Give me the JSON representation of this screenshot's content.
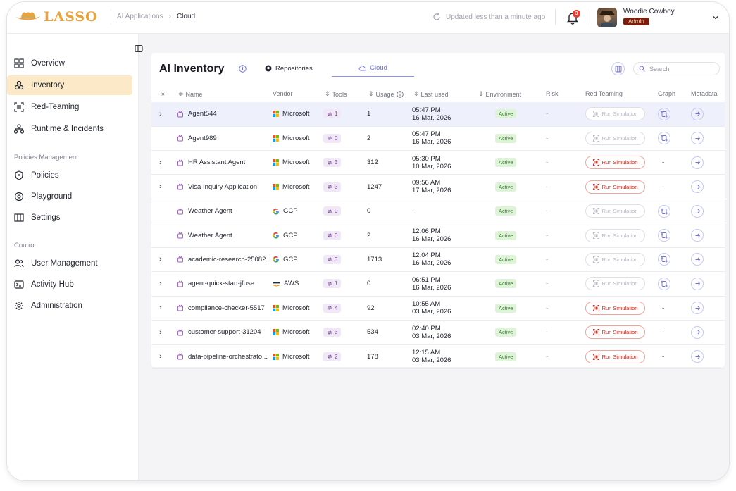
{
  "app": {
    "logo_text": "LASSO",
    "brand_color": "#e8a33d"
  },
  "breadcrumb": {
    "parent": "AI Applications",
    "current": "Cloud"
  },
  "header": {
    "updated_text": "Updated less than a minute ago",
    "notification_count": "3",
    "user_name": "Woodie Cowboy",
    "user_role": "Admin"
  },
  "sidebar": {
    "items_main": [
      {
        "label": "Overview",
        "icon": "grid-icon"
      },
      {
        "label": "Inventory",
        "icon": "inventory-icon",
        "active": true
      },
      {
        "label": "Red-Teaming",
        "icon": "red-teaming-icon"
      },
      {
        "label": "Runtime & Incidents",
        "icon": "network-icon"
      }
    ],
    "section_policies": "Policies Management",
    "items_policies": [
      {
        "label": "Policies",
        "icon": "shield-icon"
      },
      {
        "label": "Playground",
        "icon": "playground-icon"
      },
      {
        "label": "Settings",
        "icon": "columns-icon"
      }
    ],
    "section_control": "Control",
    "items_control": [
      {
        "label": "User Management",
        "icon": "users-icon"
      },
      {
        "label": "Activity Hub",
        "icon": "terminal-icon"
      },
      {
        "label": "Administration",
        "icon": "gear-icon"
      }
    ]
  },
  "main": {
    "title": "AI Inventory",
    "tabs": [
      {
        "label": "Repositories",
        "icon": "github-icon"
      },
      {
        "label": "Cloud",
        "icon": "cloud-icon",
        "active": true
      }
    ],
    "search_placeholder": "Search"
  },
  "table": {
    "columns": {
      "name": "Name",
      "vendor": "Vendor",
      "tools": "Tools",
      "usage": "Usage",
      "last_used": "Last used",
      "environment": "Environment",
      "risk": "Risk",
      "red_teaming": "Red Teaming",
      "graph": "Graph",
      "metadata": "Metadata"
    },
    "sim_label": "Run Simulation",
    "rows": [
      {
        "expand": true,
        "name": "Agent544",
        "vendor": "Microsoft",
        "tools": "1",
        "usage": "1",
        "time": "05:47 PM",
        "date": "16 Mar, 2026",
        "env": "Active",
        "risk": "-",
        "sim_enabled": false,
        "graph": true,
        "selected": true
      },
      {
        "expand": false,
        "name": "Agent989",
        "vendor": "Microsoft",
        "tools": "0",
        "usage": "2",
        "time": "05:47 PM",
        "date": "16 Mar, 2026",
        "env": "Active",
        "risk": "-",
        "sim_enabled": false,
        "graph": true
      },
      {
        "expand": true,
        "name": "HR Assistant Agent",
        "vendor": "Microsoft",
        "tools": "3",
        "usage": "312",
        "time": "05:30 PM",
        "date": "10 Mar, 2026",
        "env": "Active",
        "risk": "-",
        "sim_enabled": true,
        "graph": false
      },
      {
        "expand": true,
        "name": "Visa Inquiry Application",
        "vendor": "Microsoft",
        "tools": "3",
        "usage": "1247",
        "time": "09:56 AM",
        "date": "17 Mar, 2026",
        "env": "Active",
        "risk": "-",
        "sim_enabled": true,
        "graph": false
      },
      {
        "expand": false,
        "name": "Weather Agent",
        "vendor": "GCP",
        "tools": "0",
        "usage": "0",
        "time": "-",
        "date": "",
        "env": "Active",
        "risk": "-",
        "sim_enabled": false,
        "graph": true
      },
      {
        "expand": false,
        "name": "Weather Agent",
        "vendor": "GCP",
        "tools": "0",
        "usage": "2",
        "time": "12:06 PM",
        "date": "16 Mar, 2026",
        "env": "Active",
        "risk": "-",
        "sim_enabled": false,
        "graph": true
      },
      {
        "expand": true,
        "name": "academic-research-25082",
        "vendor": "GCP",
        "tools": "3",
        "usage": "1713",
        "time": "12:04 PM",
        "date": "16 Mar, 2026",
        "env": "Active",
        "risk": "-",
        "sim_enabled": false,
        "graph": true
      },
      {
        "expand": true,
        "name": "agent-quick-start-jfuse",
        "vendor": "AWS",
        "tools": "1",
        "usage": "0",
        "time": "06:51 PM",
        "date": "16 Mar, 2026",
        "env": "Active",
        "risk": "-",
        "sim_enabled": false,
        "graph": true
      },
      {
        "expand": true,
        "name": "compliance-checker-5517",
        "vendor": "Microsoft",
        "tools": "4",
        "usage": "92",
        "time": "10:55 AM",
        "date": "03 Mar, 2026",
        "env": "Active",
        "risk": "-",
        "sim_enabled": true,
        "graph": false
      },
      {
        "expand": true,
        "name": "customer-support-31204",
        "vendor": "Microsoft",
        "tools": "3",
        "usage": "534",
        "time": "02:40 PM",
        "date": "03 Mar, 2026",
        "env": "Active",
        "risk": "-",
        "sim_enabled": true,
        "graph": false
      },
      {
        "expand": true,
        "name": "data-pipeline-orchestrato...",
        "vendor": "Microsoft",
        "tools": "2",
        "usage": "178",
        "time": "12:15 AM",
        "date": "03 Mar, 2026",
        "env": "Active",
        "risk": "-",
        "sim_enabled": true,
        "graph": false
      }
    ],
    "empty_graph": "-"
  }
}
